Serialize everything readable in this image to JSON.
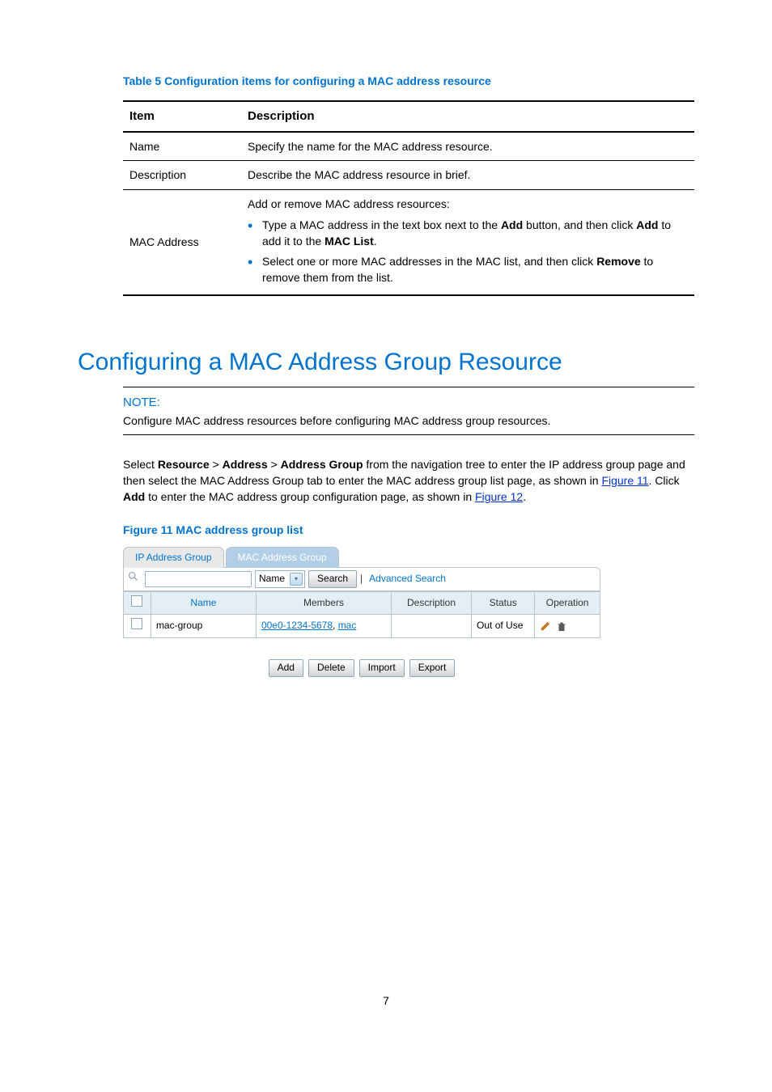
{
  "table5": {
    "caption": "Table 5 Configuration items for configuring a MAC address resource",
    "head": {
      "item": "Item",
      "desc": "Description"
    },
    "rows": {
      "name_item": "Name",
      "name_desc": "Specify the name for the MAC address resource.",
      "desc_item": "Description",
      "desc_desc": "Describe the MAC address resource in brief.",
      "mac_item": "MAC Address",
      "mac_intro": "Add or remove MAC address resources:",
      "mac_b1_a": "Type a MAC address in the text box next to the ",
      "mac_b1_add1": "Add",
      "mac_b1_b": " button, and then click ",
      "mac_b1_add2": "Add",
      "mac_b1_c": " to add it to the ",
      "mac_b1_list": "MAC List",
      "mac_b1_d": ".",
      "mac_b2_a": "Select one or more MAC addresses in the MAC list, and then click ",
      "mac_b2_remove": "Remove",
      "mac_b2_b": " to remove them from the list."
    }
  },
  "section": {
    "title": "Configuring a MAC Address Group Resource",
    "note_label": "NOTE:",
    "note_text": "Configure MAC address resources before configuring MAC address group resources."
  },
  "para": {
    "a": "Select ",
    "resource": "Resource",
    "sep1": " > ",
    "address": "Address",
    "sep2": " > ",
    "address_group": "Address Group",
    "b": " from the navigation tree to enter the IP address group page and then select the MAC Address Group tab to enter the MAC address group list page, as shown in ",
    "fig11": "Figure 11",
    "c": ". Click ",
    "add": "Add",
    "d": " to enter the MAC address group configuration page, as shown in ",
    "fig12": "Figure 12",
    "e": "."
  },
  "figure11": {
    "caption": "Figure 11 MAC address group list",
    "tab_inactive": "IP Address Group",
    "tab_active": "MAC Address Group",
    "search_field": "Name",
    "search_btn": "Search",
    "advanced": "Advanced Search",
    "columns": {
      "name": "Name",
      "members": "Members",
      "desc": "Description",
      "status": "Status",
      "op": "Operation"
    },
    "row": {
      "name": "mac-group",
      "member1": "00e0-1234-5678",
      "member_sep": ", ",
      "member2": "mac",
      "desc": "",
      "status": "Out of Use"
    },
    "buttons": {
      "add": "Add",
      "delete": "Delete",
      "import": "Import",
      "export": "Export"
    }
  },
  "page_number": "7"
}
